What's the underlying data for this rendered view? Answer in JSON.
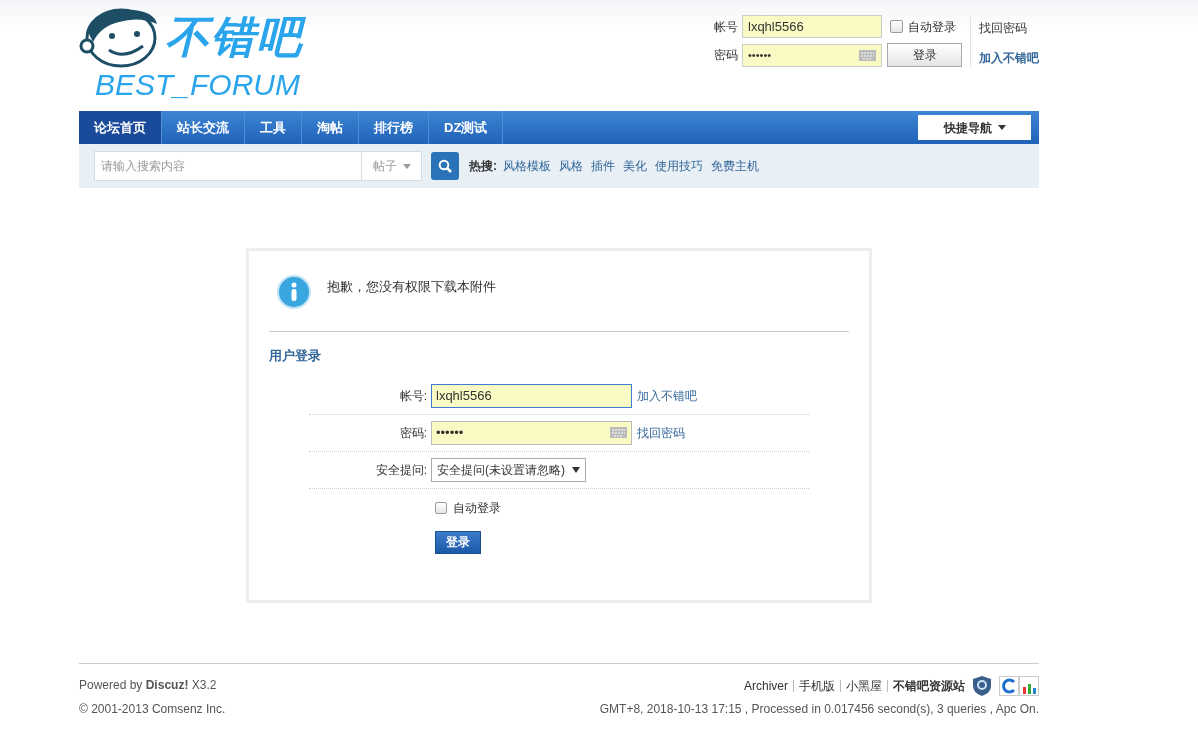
{
  "logo": {
    "title": "不错吧",
    "subtitle": "BEST_FORUM"
  },
  "header_login": {
    "username_label": "帐号",
    "username_value": "lxqhl5566",
    "password_label": "密码",
    "password_value": "••••••",
    "auto_login": {
      "label": "自动登录",
      "checked": false
    },
    "login_button": "登录",
    "links": [
      "找回密码",
      "加入不错吧"
    ]
  },
  "nav": {
    "tabs": [
      {
        "label": "论坛首页",
        "selected": true
      },
      {
        "label": "站长交流",
        "selected": false
      },
      {
        "label": "工具",
        "selected": false
      },
      {
        "label": "淘帖",
        "selected": false
      },
      {
        "label": "排行榜",
        "selected": false
      },
      {
        "label": "DZ测试",
        "selected": false
      }
    ],
    "quick_nav": "快捷导航"
  },
  "search": {
    "placeholder": "请输入搜索内容",
    "scope": "帖子",
    "hot_label": "热搜:",
    "hot_terms": [
      "风格模板",
      "风格",
      "插件",
      "美化",
      "使用技巧",
      "免费主机"
    ]
  },
  "notice": {
    "message": "抱歉，您没有权限下载本附件"
  },
  "login_form": {
    "title": "用户登录",
    "rows": [
      {
        "kind": "text",
        "label": "帐号:",
        "value": "lxqhl5566",
        "focused": true,
        "link": "加入不错吧"
      },
      {
        "kind": "password",
        "label": "密码:",
        "value": "••••••",
        "focused": false,
        "link": "找回密码"
      },
      {
        "kind": "select",
        "label": "安全提问:",
        "value": "安全提问(未设置请忽略)"
      }
    ],
    "auto_login": {
      "label": "自动登录",
      "checked": false
    },
    "submit": "登录"
  },
  "footer": {
    "powered_by": "Powered by **Discuz!** X3.2",
    "copyright": "© 2001-2013 Comsenz Inc.",
    "links": [
      "Archiver",
      "手机版",
      "小黑屋",
      "不错吧资源站"
    ],
    "stats": "GMT+8, 2018-10-13 17:15 , Processed in 0.017456 second(s), 3 queries , Apc On."
  }
}
